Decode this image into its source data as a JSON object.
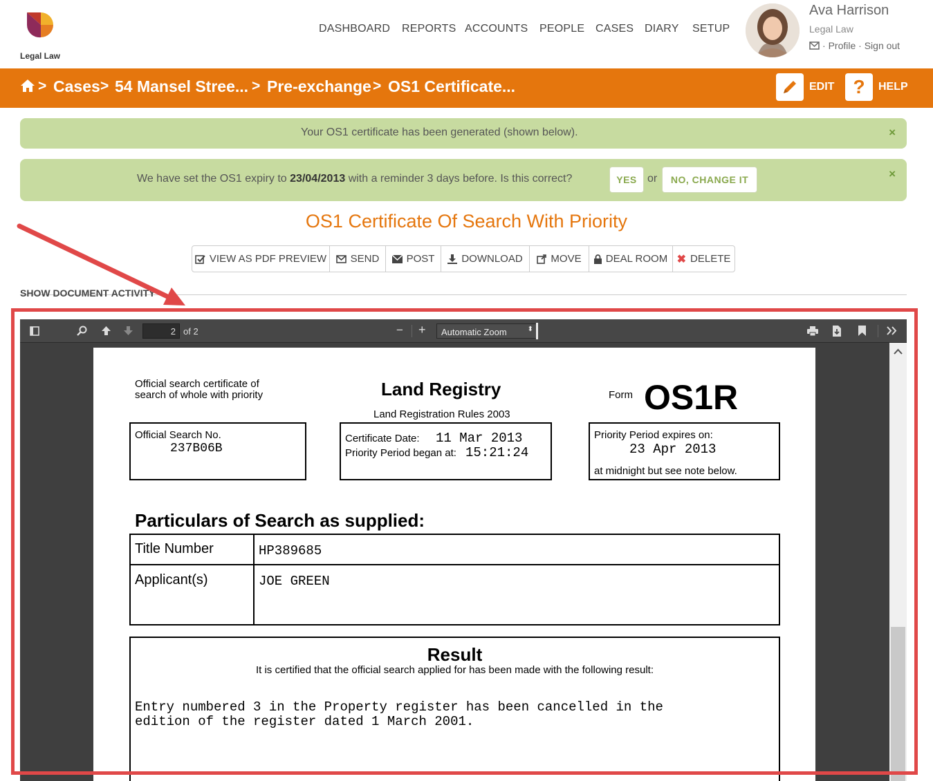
{
  "app": {
    "logo_text": "Legal Law"
  },
  "nav": [
    "DASHBOARD",
    "REPORTS",
    "ACCOUNTS",
    "PEOPLE",
    "CASES",
    "DIARY",
    "SETUP"
  ],
  "user": {
    "name": "Ava Harrison",
    "firm": "Legal Law",
    "profile": "Profile",
    "sep": "·",
    "signout": "Sign out"
  },
  "breadcrumb": {
    "sep": ">",
    "items": [
      "Cases",
      "54 Mansel Stree...",
      "Pre-exchange",
      "OS1 Certificate..."
    ]
  },
  "header_buttons": {
    "edit": "EDIT",
    "help": "HELP"
  },
  "alerts": {
    "generated": "Your OS1 certificate has been generated (shown below).",
    "expiry_pre": "We have set the OS1 expiry to",
    "expiry_date": "23/04/2013",
    "expiry_post": "with a reminder 3 days before.  Is this correct?",
    "yes": "YES",
    "or": "or",
    "change": "NO, CHANGE IT",
    "close": "×"
  },
  "document": {
    "title": "OS1 Certificate Of Search With Priority",
    "actions": {
      "preview": "VIEW AS PDF PREVIEW",
      "send": "SEND",
      "post": "POST",
      "download": "DOWNLOAD",
      "move": "MOVE",
      "dealroom": "DEAL ROOM",
      "delete": "DELETE"
    },
    "show_activity": "SHOW DOCUMENT ACTIVITY"
  },
  "pdf_viewer": {
    "page": "2",
    "of": "of 2",
    "zoom": "Automatic Zoom"
  },
  "certificate": {
    "heading_left_1": "Official search certificate of",
    "heading_left_2": "search of whole with priority",
    "registry": "Land Registry",
    "rules": "Land Registration Rules 2003",
    "form_label": "Form",
    "form_code": "OS1R",
    "search_no_label": "Official Search No.",
    "search_no": "237B06B",
    "cert_date_label": "Certificate Date:",
    "cert_date": "11 Mar 2013",
    "priority_began_label": "Priority Period began at:",
    "priority_began": "15:21:24",
    "priority_expires_label": "Priority Period expires on:",
    "priority_expires": "23 Apr 2013",
    "midnight_note": "at midnight but see note below.",
    "particulars_heading": "Particulars of Search as supplied:",
    "title_number_label": "Title Number",
    "title_number": "HP389685",
    "applicants_label": "Applicant(s)",
    "applicants": "JOE GREEN",
    "result_heading": "Result",
    "result_intro": "It is certified that the official search applied for has been made with the following result:",
    "result_line_1": "Entry numbered 3 in the Property register has been cancelled in the",
    "result_line_2": "edition of the register dated 1 March 2001."
  }
}
